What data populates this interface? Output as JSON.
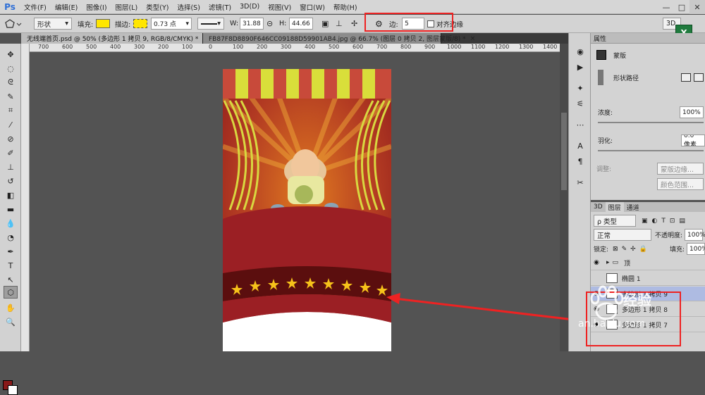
{
  "app": {
    "logo": "Ps"
  },
  "menu": [
    "文件(F)",
    "编辑(E)",
    "图像(I)",
    "图层(L)",
    "类型(Y)",
    "选择(S)",
    "滤镜(T)",
    "3D(D)",
    "视图(V)",
    "窗口(W)",
    "帮助(H)"
  ],
  "window_buttons": [
    "—",
    "□",
    "✕"
  ],
  "options": {
    "shape_mode": "形状",
    "fill_label": "填充:",
    "fill_color": "#ffe600",
    "stroke_label": "描边:",
    "stroke_width": "0.73 点",
    "w_label": "W:",
    "w_value": "31.88",
    "h_label": "H:",
    "h_value": "44.66",
    "sides_label": "边:",
    "sides_value": "5",
    "align_edges_label": "对齐边缘",
    "workspace": "3D"
  },
  "doc_tabs": [
    "无线端首页.psd @ 50% (多边形 1 拷贝 9, RGB/8/CMYK) *",
    "FB87F8D8890F646CC09188D59901AB4.jpg @ 66.7% (图层 0 拷贝 2, 图层蒙版/8) *"
  ],
  "ruler_ticks": [
    "700",
    "600",
    "500",
    "400",
    "300",
    "200",
    "100",
    "0",
    "100",
    "200",
    "300",
    "400",
    "500",
    "600",
    "700",
    "800",
    "900",
    "1000",
    "1100",
    "1200",
    "1300",
    "1400"
  ],
  "properties": {
    "title": "属性",
    "mask_label": "蒙版",
    "shape_path_label": "形状路径",
    "density_label": "浓度:",
    "density_value": "100%",
    "feather_label": "羽化:",
    "feather_value": "0.0 像素",
    "adjust_label": "调整:",
    "mask_edge_btn": "蒙版边缘...",
    "color_range_btn": "颜色范围..."
  },
  "layers": {
    "tabs": [
      "3D",
      "图层",
      "通道"
    ],
    "filter_kind": "ρ 类型",
    "blend_mode": "正常",
    "opacity_label": "不透明度:",
    "opacity_value": "100%",
    "lock_label": "锁定:",
    "fill_label": "填充:",
    "fill_value": "100%",
    "items": [
      {
        "name": "顶",
        "type": "group"
      },
      {
        "name": "椭圆 1",
        "type": "shape"
      },
      {
        "name": "多边形 1 拷贝 9",
        "type": "shape"
      },
      {
        "name": "多边形 1 拷贝 8",
        "type": "shape"
      },
      {
        "name": "多边形 1 拷贝 7",
        "type": "shape"
      }
    ]
  },
  "watermark": {
    "brand": "经验",
    "url": "jingyan.baidu.com",
    "visible_url": "an.baidu.com"
  }
}
